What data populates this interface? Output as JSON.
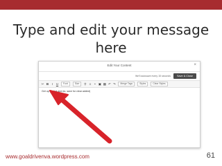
{
  "slide": {
    "title": "Type and edit your message here",
    "footer_url": "www.goaldrivenva.wordpress.com",
    "page_number": "61",
    "accent_color": "#a72c2f",
    "arrow_color": "#d8232a"
  },
  "dialog": {
    "title": "Edit Your Content",
    "status": "We'll autosave every 15 seconds",
    "save_label": "Save & Close",
    "close_icon": "×",
    "toolbar": {
      "icons": [
        "cut-icon",
        "copy-icon",
        "paste-icon",
        "bold-icon",
        "italic-icon",
        "underline-icon",
        "strike-icon",
        "align-left-icon",
        "align-center-icon",
        "align-right-icon",
        "bullets-icon",
        "numbering-icon",
        "link-icon",
        "image-icon",
        "table-icon",
        "undo-icon",
        "redo-icon"
      ],
      "selects": [
        "Font",
        "Size",
        "Merge Tags",
        "Styles",
        "Clear Styles"
      ]
    },
    "editor_text": "Get up (select and do, save for clear added)"
  }
}
